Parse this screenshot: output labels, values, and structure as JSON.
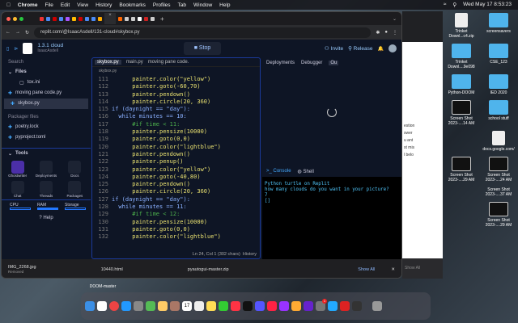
{
  "menubar": {
    "items": [
      "Chrome",
      "File",
      "Edit",
      "View",
      "History",
      "Bookmarks",
      "Profiles",
      "Tab",
      "Window",
      "Help"
    ],
    "clock": "Wed May 17  8:53:23"
  },
  "browser": {
    "url": "replit.com/@IsaacAsdell/131-cloud#skybox.py"
  },
  "replit": {
    "repl_name": "1.3.1 cloud",
    "owner": "IsaacAsdell",
    "stop": "Stop",
    "invite": "Invite",
    "release": "Release",
    "search": "Search"
  },
  "sidebar": {
    "files_header": "Files",
    "files": [
      "tox.ini",
      "moving pane code.py",
      "skybox.py"
    ],
    "packager_header": "Packager files",
    "packager": [
      "poetry.lock",
      "pyproject.toml"
    ],
    "tools_header": "Tools",
    "tools": [
      "Ghostwriter",
      "Deployments",
      "Docs",
      "Chat",
      "Threads",
      "Packages"
    ],
    "resources": [
      "CPU",
      "RAM",
      "Storage"
    ],
    "help": "Help"
  },
  "editor": {
    "tabs": [
      "skybox.py",
      "main.py",
      "moving pane code."
    ],
    "breadcrumb": "skybox.py",
    "status": "Ln 24, Col 1 (302 chars)",
    "history": "History",
    "lines": [
      {
        "n": "111",
        "t": "      painter.color(\"yellow\")"
      },
      {
        "n": "112",
        "t": "      painter.goto(-60,70)"
      },
      {
        "n": "113",
        "t": "      painter.pendown()"
      },
      {
        "n": "114",
        "t": "      painter.circle(20, 360)"
      },
      {
        "n": "115",
        "t": "if (daynight == \"day\"):"
      },
      {
        "n": "116",
        "t": "  while minutes == 10:"
      },
      {
        "n": "117",
        "t": "      #if time < 11:"
      },
      {
        "n": "118",
        "t": "      painter.pensize(10000)"
      },
      {
        "n": "119",
        "t": "      painter.goto(0,0)"
      },
      {
        "n": "120",
        "t": "      painter.color(\"lightblue\")"
      },
      {
        "n": "121",
        "t": "      painter.pendown()"
      },
      {
        "n": "122",
        "t": "      painter.penup()"
      },
      {
        "n": "123",
        "t": "      painter.color(\"yellow\")"
      },
      {
        "n": "124",
        "t": "      painter.goto(-40,80)"
      },
      {
        "n": "125",
        "t": "      painter.pendown()"
      },
      {
        "n": "126",
        "t": "      painter.circle(20, 360)"
      },
      {
        "n": "127",
        "t": "if (daynight == \"day\"):"
      },
      {
        "n": "128",
        "t": "  while minutes == 11:"
      },
      {
        "n": "129",
        "t": "      #if time < 12:"
      },
      {
        "n": "130",
        "t": "      painter.pensize(10000)"
      },
      {
        "n": "131",
        "t": "      painter.goto(0,0)"
      },
      {
        "n": "132",
        "t": "      painter.color(\"lightblue\")"
      }
    ]
  },
  "right": {
    "tabs": [
      "Deployments",
      "Debugger",
      "Ou"
    ],
    "console_tabs": [
      "Console",
      "Shell"
    ],
    "console_output": "Python turtle on Replit\nhow many clouds do you want in your picture?\n7\n[]"
  },
  "downloads": {
    "items": [
      {
        "name": "IMG_2268.jpg",
        "sub": "Removed"
      },
      {
        "name": "10440.html"
      },
      {
        "name": "pyautogui-master.zip"
      }
    ],
    "show_all": "Show All"
  },
  "behind_window": {
    "text": [
      "estion",
      "swer",
      "u ant",
      "st mis",
      "l belo"
    ],
    "show_all": "Show All"
  },
  "desktop": {
    "items": [
      "Trinket Downl...c4.zip",
      "screensavers",
      "Trinket Downl....9e098",
      "CSE_123",
      "Python-DOOM",
      "IED 2020",
      "Screen Shot 2023-....14 AM",
      "school stuff",
      "docs.google.com/",
      "Screen Shot 2023-....24 AM",
      "Screen Shot 2023-....29 AM",
      "Screen Shot 2023-....37 AM",
      "Screen Shot 2023-....29 AM",
      "DOOM-master"
    ]
  },
  "dock": {
    "calendar_day": "17",
    "badge": "1"
  }
}
